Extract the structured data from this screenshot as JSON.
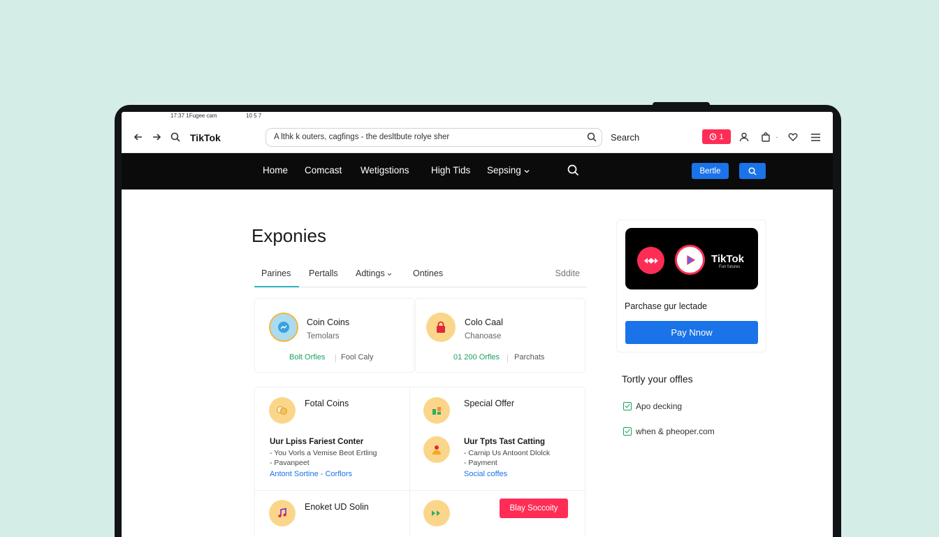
{
  "statusbar": {
    "left": "17:37  1Fugee cam",
    "right": "10 5 7"
  },
  "browser": {
    "brand": "TikTok",
    "url_text": "A lthk k outers, cagfings - the desltbute rolye sher",
    "search_label": "Search",
    "notification_count": "1"
  },
  "nav": {
    "items": [
      "Home",
      "Comcast",
      "Wetigstions",
      "High Tids",
      "Sepsing"
    ],
    "button_label": "Bertle"
  },
  "page": {
    "title": "Exponies",
    "tabs": [
      "Parines",
      "Pertalls",
      "Adtings",
      "Ontines"
    ],
    "tab_right": "Sddite"
  },
  "cards": [
    {
      "title": "Coin Coins",
      "subtitle": "Temolars",
      "link1": "Bolt Orfies",
      "link2": "Fool Caly"
    },
    {
      "title": "Colo Caal",
      "subtitle": "Chanoase",
      "link1": "01 200 Orfles",
      "link2": "Parchats"
    }
  ],
  "lower": {
    "left_title": "Fotal Coins",
    "left_heading": "Uur Lpiss Fariest Conter",
    "left_line1": "- You Vorls a Vemise Beot Ertling",
    "left_line2": "- Pavanpeet",
    "left_link": "Antont Sortine - Corflors",
    "right_title": "Special Offer",
    "right_heading": "Uur Tpts Tast Catting",
    "right_line1": "- Carnip Us Antoont Dlolck",
    "right_line2": "- Payment",
    "right_link": "Social coffes",
    "bottom_left_title": "Enoket UD Solin",
    "bottom_button": "Blay Soccoity"
  },
  "right_panel": {
    "promo_title": "TikTok",
    "promo_sub": "Fun futures",
    "purchase_text": "Parchase gur lectade",
    "pay_button": "Pay Nnow",
    "offers_title": "Tortly your offles",
    "offers": [
      "Apo decking",
      "when & pheoper.com"
    ]
  },
  "colors": {
    "accent_blue": "#1a73e8",
    "accent_red": "#ff2d55",
    "link_green": "#1ba35a",
    "link_blue": "#1a73e8"
  }
}
